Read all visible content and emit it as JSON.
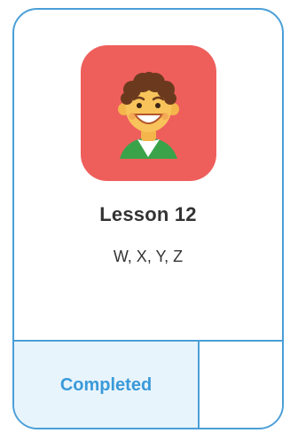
{
  "lesson": {
    "title": "Lesson 12",
    "letters": "W, X, Y, Z",
    "avatar_icon": "smiling-boy-avatar-icon",
    "status_label": "Completed"
  },
  "colors": {
    "card_border": "#4a9fd8",
    "avatar_tile": "#ee5f5b",
    "status_bg": "#e8f4fc",
    "status_text": "#3a9ad9",
    "text": "#333333"
  }
}
